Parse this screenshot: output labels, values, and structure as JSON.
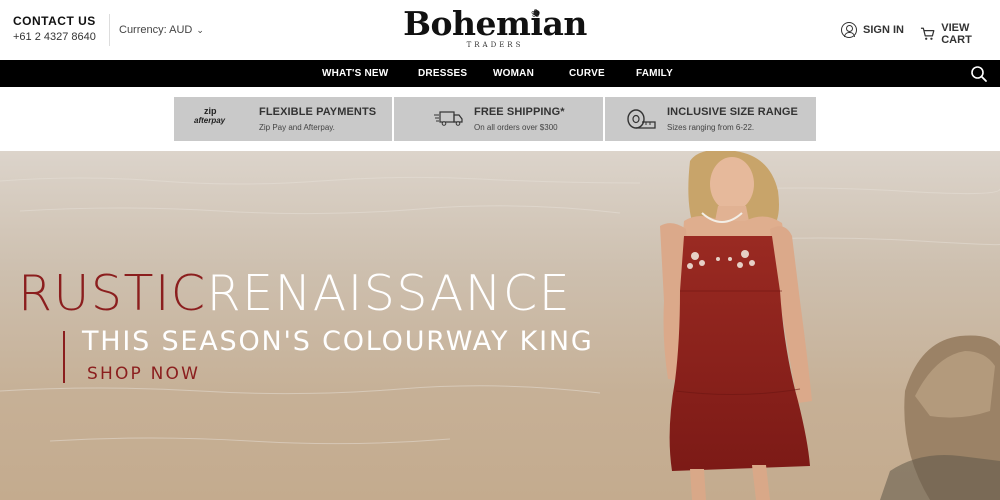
{
  "header": {
    "contact_title": "CONTACT US",
    "contact_phone": "+61 2 4327 8640",
    "currency_label": "Currency: AUD",
    "currency_chevron_icon": "chevron-down-icon",
    "logo_main": "Bohemian",
    "logo_sub": "TRADERS",
    "sign_in_label": "SIGN IN",
    "view_cart_label": "VIEW CART"
  },
  "nav": {
    "items": [
      "WHAT'S NEW",
      "DRESSES",
      "WOMAN",
      "CURVE",
      "FAMILY"
    ],
    "search_icon": "search-icon"
  },
  "benefits": [
    {
      "title": "FLEXIBLE PAYMENTS",
      "subtitle": "Zip Pay and Afterpay.",
      "logo_zip": "zip",
      "logo_afterpay": "afterpay"
    },
    {
      "title": "FREE SHIPPING*",
      "subtitle": "On all orders over $300",
      "icon": "truck-icon"
    },
    {
      "title": "INCLUSIVE SIZE RANGE",
      "subtitle": "Sizes ranging from 6-22.",
      "icon": "measuring-tape-icon"
    }
  ],
  "hero": {
    "title_part1": "RUSTIC",
    "title_part2": "RENAISSANCE",
    "subtitle": "THIS SEASON'S COLOURWAY KING",
    "cta": "SHOP NOW",
    "accent_color": "#8b1e1e"
  },
  "colors": {
    "nav_background": "#000000",
    "benefit_background": "#c9c9c9",
    "accent": "#8b1e1e"
  }
}
